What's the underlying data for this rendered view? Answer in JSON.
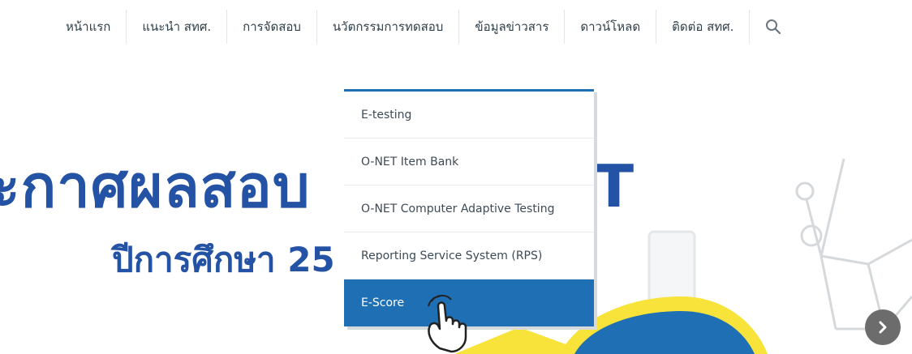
{
  "nav": {
    "items": [
      "หน้าแรก",
      "แนะนำ สทศ.",
      "การจัดสอบ",
      "นวัตกรรมการทดสอบ",
      "ข้อมูลข่าวสาร",
      "ดาวน์โหลด",
      "ติดต่อ สทศ."
    ],
    "search_icon": "search-icon"
  },
  "dropdown": {
    "items": [
      "E-testing",
      "O-NET Item Bank",
      "O-NET Computer Adaptive Testing",
      "Reporting Service System (RPS)",
      "E-Score"
    ],
    "active_index": 4,
    "accent_color": "#1f6fb5"
  },
  "hero": {
    "title_left": "ะกาศผลสอบ",
    "title_right": "T",
    "subtitle": "ปีการศึกษา 25"
  },
  "colors": {
    "nav_text": "#2f3f4a",
    "hero_text": "#2452a4",
    "highlight_yellow": "#f7e33a"
  },
  "icons": {
    "next": "chevron-right-icon",
    "cursor": "hand-pointer-icon"
  }
}
